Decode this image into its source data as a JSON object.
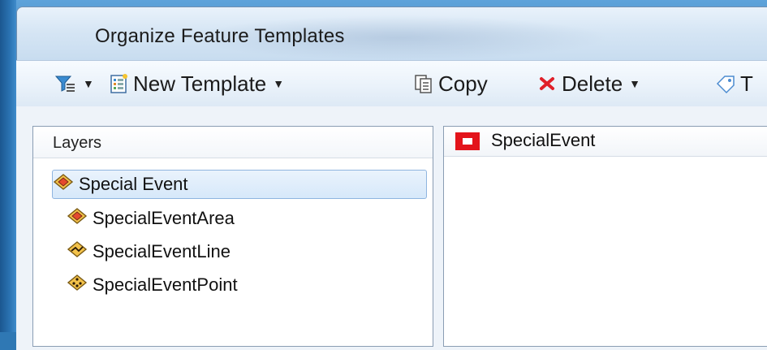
{
  "window": {
    "title": "Organize Feature Templates"
  },
  "toolbar": {
    "new_template_label": "New Template",
    "copy_label": "Copy",
    "delete_label": "Delete",
    "tag_label": "T"
  },
  "layers": {
    "header": "Layers",
    "items": [
      {
        "label": "Special Event",
        "icon": "polygon-layer-icon",
        "selected": true
      },
      {
        "label": "SpecialEventArea",
        "icon": "polygon-layer-icon",
        "selected": false
      },
      {
        "label": "SpecialEventLine",
        "icon": "line-layer-icon",
        "selected": false
      },
      {
        "label": "SpecialEventPoint",
        "icon": "point-layer-icon",
        "selected": false
      }
    ]
  },
  "templates": {
    "header_label": "SpecialEvent",
    "swatch_color": "#e3141b"
  }
}
